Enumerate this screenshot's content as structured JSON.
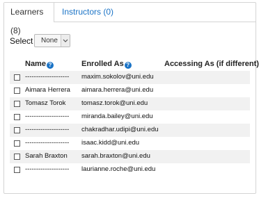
{
  "tabs": [
    {
      "label": "Learners (8)",
      "active": true
    },
    {
      "label": "Instructors (0)",
      "active": false
    }
  ],
  "select": {
    "label": "Select",
    "value": "None"
  },
  "columns": {
    "name": "Name",
    "enrolled_as": "Enrolled As",
    "accessing_as": "Accessing As (if different)",
    "help_icon": "question-circle"
  },
  "rows": [
    {
      "name": "--------------------",
      "email": "maxim.sokolov@uni.edu"
    },
    {
      "name": "Aimara Herrera",
      "email": "aimara.herrera@uni.edu"
    },
    {
      "name": "Tomasz Torok",
      "email": "tomasz.torok@uni.edu"
    },
    {
      "name": "--------------------",
      "email": "miranda.bailey@uni.edu"
    },
    {
      "name": "--------------------",
      "email": "chakradhar.udipi@uni.edu"
    },
    {
      "name": "--------------------",
      "email": "isaac.kidd@uni.edu"
    },
    {
      "name": "Sarah Braxton",
      "email": "sarah.braxton@uni.edu"
    },
    {
      "name": "--------------------",
      "email": "laurianne.roche@uni.edu"
    }
  ],
  "colors": {
    "link": "#1a73c6",
    "row_shade": "#f1f1f1",
    "border": "#d4d4d4"
  }
}
